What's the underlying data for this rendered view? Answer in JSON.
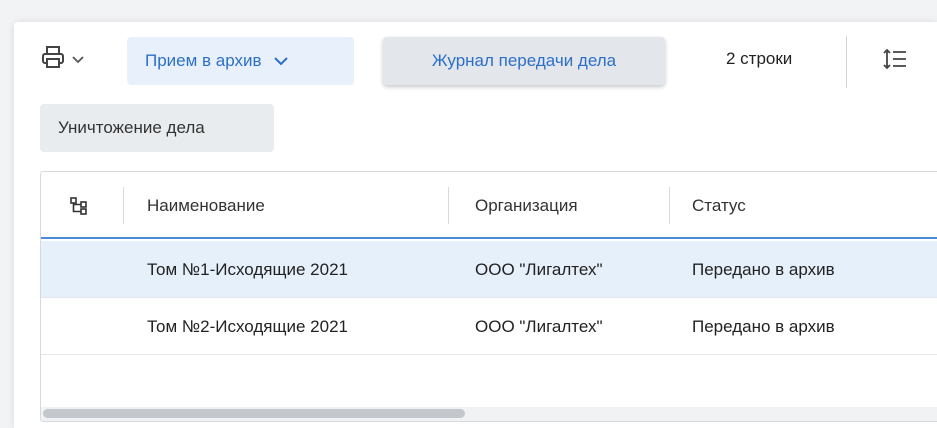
{
  "toolbar": {
    "print_icon": "printer-icon",
    "print_chevron": "chevron-down-icon",
    "accept_archive_label": "Прием в архив",
    "journal_label": "Журнал передачи дела",
    "rows_count": "2 строки",
    "density_icon": "row-density-icon",
    "destroy_label": "Уничтожение дела"
  },
  "table": {
    "tree_icon": "tree-structure-icon",
    "columns": [
      "Наименование",
      "Организация",
      "Статус"
    ],
    "rows": [
      {
        "name": "Том №1-Исходящие 2021",
        "org": "ООО \"Лигалтех\"",
        "status": "Передано в архив",
        "selected": true
      },
      {
        "name": "Том №2-Исходящие 2021",
        "org": "ООО \"Лигалтех\"",
        "status": "Передано в архив",
        "selected": false
      }
    ]
  },
  "colors": {
    "accent": "#2c6fc7",
    "selected_row": "#e6f0fb",
    "header_underline": "#4a8ad6"
  }
}
